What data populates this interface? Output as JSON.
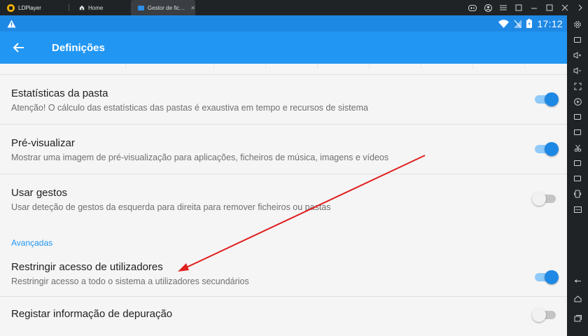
{
  "emulator": {
    "app_name": "LDPlayer",
    "tabs": [
      {
        "label": "Home"
      },
      {
        "label": "Gestor de fic…"
      }
    ]
  },
  "statusbar": {
    "time": "17:12"
  },
  "appbar": {
    "title": "Definições"
  },
  "settings": {
    "items": [
      {
        "title": "Estatísticas da pasta",
        "subtitle": "Atenção! O cálculo das estatísticas das pastas é exaustiva em tempo e recursos de sistema",
        "enabled": true
      },
      {
        "title": "Pré-visualizar",
        "subtitle": "Mostrar uma imagem de pré-visualização para aplicações, ficheiros de música, imagens e vídeos",
        "enabled": true
      },
      {
        "title": "Usar gestos",
        "subtitle": "Usar deteção de gestos da esquerda para direita para remover ficheiros ou pastas",
        "enabled": false
      }
    ],
    "section_advanced": "Avançadas",
    "advanced_items": [
      {
        "title": "Restringir acesso de utilizadores",
        "subtitle": "Restringir acesso a todo o sistema a utilizadores secundários",
        "enabled": true
      },
      {
        "title": "Registar informação de depuração",
        "enabled": false
      }
    ]
  },
  "colors": {
    "primary": "#2196f3",
    "status_bar": "#1e88e5",
    "toggle_on": "#1e88e5",
    "annotation_arrow": "#e02020"
  }
}
